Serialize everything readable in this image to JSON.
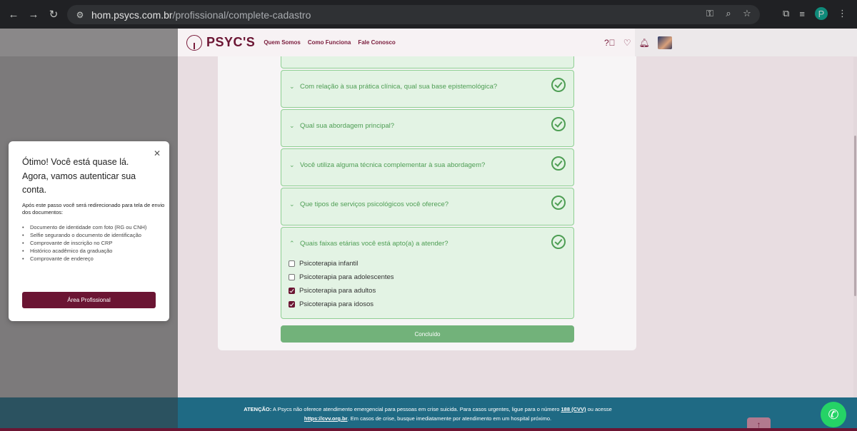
{
  "browser": {
    "url_domain": "hom.psycs.com.br",
    "url_path": "/profissional/complete-cadastro"
  },
  "header": {
    "logo": "PSYC'S",
    "nav": [
      "Quem Somos",
      "Como Funciona",
      "Fale Conosco"
    ]
  },
  "questions": [
    {
      "title": "Com relação à sua prática clínica, qual sua base epistemológica?"
    },
    {
      "title": "Qual sua abordagem principal?"
    },
    {
      "title": "Você utiliza alguma técnica complementar à sua abordagem?"
    },
    {
      "title": "Que tipos de serviços psicológicos você oferece?"
    },
    {
      "title": "Quais faixas etárias você está apto(a) a atender?"
    }
  ],
  "age_options": [
    {
      "label": "Psicoterapia infantil",
      "checked": false
    },
    {
      "label": "Psicoterapia para adolescentes",
      "checked": false
    },
    {
      "label": "Psicoterapia para adultos",
      "checked": true
    },
    {
      "label": "Psicoterapia para idosos",
      "checked": true
    }
  ],
  "done_button": "Concluído",
  "popup": {
    "title": "Ótimo! Você está quase lá. Agora, vamos autenticar sua conta.",
    "text": "Após este passo você será redirecionado para tela de envio dos documentos:",
    "items": [
      "Documento de identidade com foto (RG ou CNH)",
      "Selfie segurando o documento de identificação",
      "Comprovante de inscrição no CRP",
      "Histórico acadêmico da graduação",
      "Comprovante de endereço"
    ],
    "button": "Área Profissional"
  },
  "footer": {
    "label": "ATENÇÃO:",
    "text1": " A Psycs não oferece atendimento emergencial para pessoas em crise suicida. Para casos urgentes, ligue para o número ",
    "cvv": "188 (CVV)",
    "text2": " ou acesse",
    "link": "https://cvv.org.br",
    "text3": ". Em casos de crise, busque imediatamente por atendimento em um hospital próximo."
  }
}
